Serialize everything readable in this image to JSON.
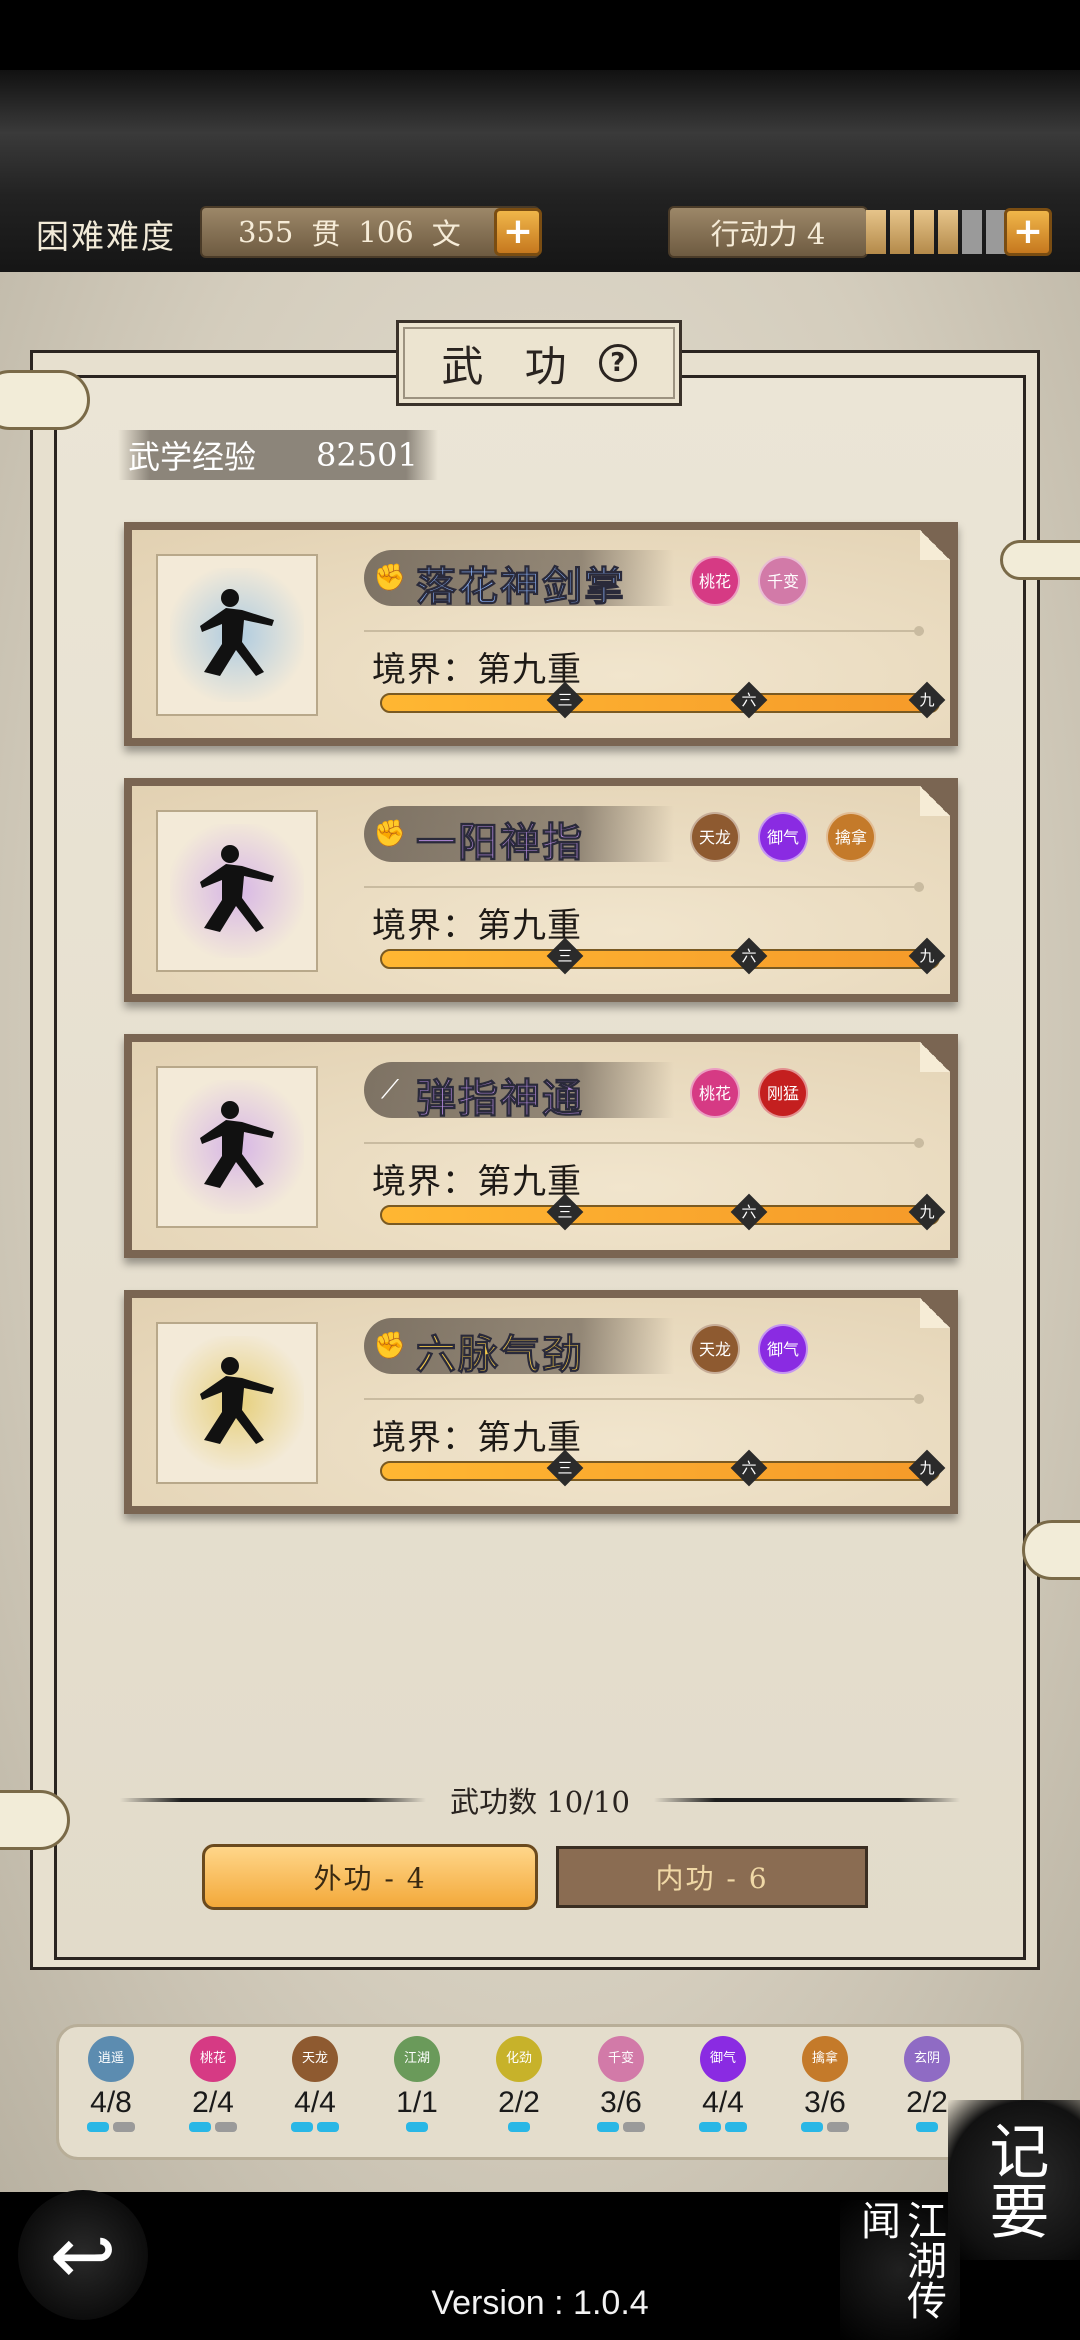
{
  "header": {
    "difficulty": "困难难度",
    "money_guan_value": "355",
    "money_guan_unit": "贯",
    "money_wen_value": "106",
    "money_wen_unit": "文",
    "action_label": "行动力 4",
    "energy": {
      "filled": 4,
      "total": 6
    }
  },
  "panel": {
    "title": "武 功",
    "exp_label": "武学经验",
    "exp_value": "82501"
  },
  "skills": [
    {
      "name": "落花神剑掌",
      "color": "#8fb7ff",
      "icon": "fist-icon",
      "icon_glyph": "✊",
      "realm": "境界：第九重",
      "progress": 1.0,
      "tags": [
        {
          "text": "桃花",
          "color": "#d63a84"
        },
        {
          "text": "千变",
          "color": "#d27aa8"
        }
      ],
      "portrait_bg": "#aecbe0"
    },
    {
      "name": "一阳禅指",
      "color": "#b78ce0",
      "icon": "fist-icon",
      "icon_glyph": "✊",
      "realm": "境界：第九重",
      "progress": 1.0,
      "tags": [
        {
          "text": "天龙",
          "color": "#8e5a30"
        },
        {
          "text": "御气",
          "color": "#8a2be2"
        },
        {
          "text": "擒拿",
          "color": "#c47a2a"
        }
      ],
      "portrait_bg": "#d7b6e6"
    },
    {
      "name": "弹指神通",
      "color": "#b78ce0",
      "icon": "blade-icon",
      "icon_glyph": "⟋",
      "realm": "境界：第九重",
      "progress": 1.0,
      "tags": [
        {
          "text": "桃花",
          "color": "#d63a84"
        },
        {
          "text": "刚猛",
          "color": "#c41f1f"
        }
      ],
      "portrait_bg": "#d7b6e6"
    },
    {
      "name": "六脉气劲",
      "color": "#f0c74a",
      "icon": "fist-icon",
      "icon_glyph": "✊",
      "realm": "境界：第九重",
      "progress": 1.0,
      "tags": [
        {
          "text": "天龙",
          "color": "#8e5a30"
        },
        {
          "text": "御气",
          "color": "#8a2be2"
        }
      ],
      "portrait_bg": "#e6cf7a"
    }
  ],
  "bar_marks": [
    "三",
    "六",
    "九"
  ],
  "footer": {
    "count_label": "武功数 10/10",
    "external_button": "外功 - 4",
    "internal_button": "内功 - 6"
  },
  "tray": [
    {
      "tag": "逍遥",
      "color": "#5c8cb0",
      "count": "4/8",
      "on": 1,
      "off": 1
    },
    {
      "tag": "桃花",
      "color": "#d63a84",
      "count": "2/4",
      "on": 1,
      "off": 1
    },
    {
      "tag": "天龙",
      "color": "#8e5a30",
      "count": "4/4",
      "on": 2,
      "off": 0
    },
    {
      "tag": "江湖",
      "color": "#6a9a5a",
      "count": "1/1",
      "on": 1,
      "off": 0
    },
    {
      "tag": "化劲",
      "color": "#c7b22a",
      "count": "2/2",
      "on": 1,
      "off": 0
    },
    {
      "tag": "千变",
      "color": "#d27aa8",
      "count": "3/6",
      "on": 1,
      "off": 1
    },
    {
      "tag": "御气",
      "color": "#8a2be2",
      "count": "4/4",
      "on": 2,
      "off": 0
    },
    {
      "tag": "擒拿",
      "color": "#c47a2a",
      "count": "3/6",
      "on": 1,
      "off": 1
    },
    {
      "tag": "玄阴",
      "color": "#8f6bc4",
      "count": "2/2",
      "on": 1,
      "off": 0
    }
  ],
  "bottom": {
    "version": "Version : 1.0.4",
    "memo": "记要",
    "legend": "江湖传闻",
    "back_icon": "back-arrow-icon"
  },
  "colors": {
    "pip_on": "#29b7e6",
    "pip_off": "#9a9a9a",
    "accent_orange": "#f59a2a"
  }
}
